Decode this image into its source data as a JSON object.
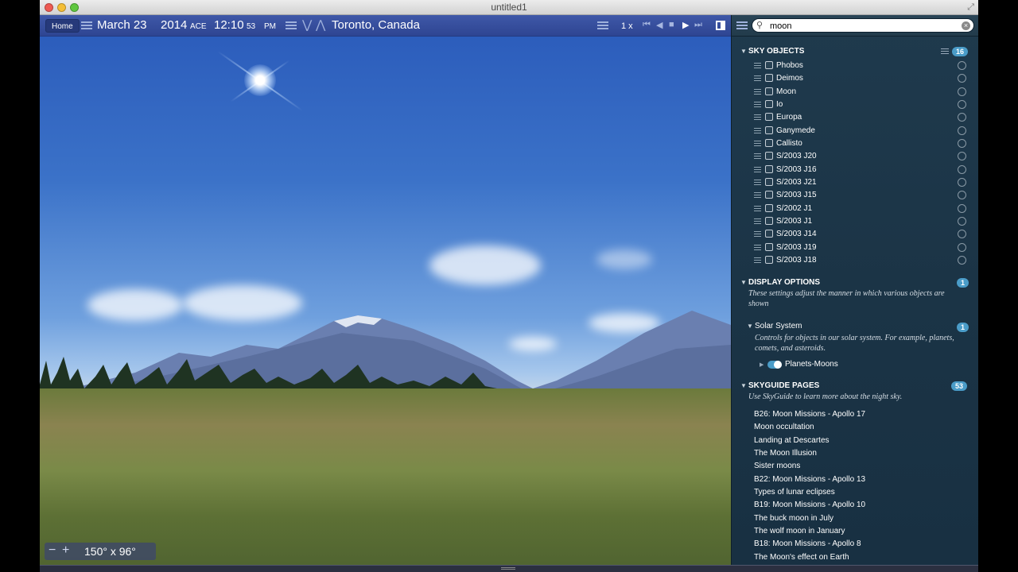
{
  "window": {
    "title": "untitled1"
  },
  "toolbar": {
    "home_label": "Home",
    "date": "March 23",
    "year": "2014",
    "era": "ACE",
    "time": "12:10",
    "seconds": "53",
    "ampm": "PM",
    "location": "Toronto, Canada",
    "speed": "1 x"
  },
  "fov": {
    "label": "150° x 96°"
  },
  "search": {
    "value": "moon"
  },
  "sky_objects": {
    "title": "SKY OBJECTS",
    "count": "16",
    "items": [
      "Phobos",
      "Deimos",
      "Moon",
      "Io",
      "Europa",
      "Ganymede",
      "Callisto",
      "S/2003 J20",
      "S/2003 J16",
      "S/2003 J21",
      "S/2003 J15",
      "S/2002 J1",
      "S/2003 J1",
      "S/2003 J14",
      "S/2003 J19",
      "S/2003 J18"
    ]
  },
  "display_options": {
    "title": "DISPLAY OPTIONS",
    "count": "1",
    "description": "These settings adjust the manner in which various objects are shown",
    "solar_system": {
      "title": "Solar System",
      "count": "1",
      "description": "Controls for objects in our solar system. For example, planets, comets, and asteroids.",
      "toggle_label": "Planets-Moons"
    }
  },
  "skyguide": {
    "title": "SKYGUIDE PAGES",
    "count": "53",
    "description": "Use SkyGuide to learn more about the night sky.",
    "pages": [
      "B26: Moon Missions - Apollo 17",
      "Moon occultation",
      "Landing at Descartes",
      "The Moon Illusion",
      "Sister moons",
      "B22: Moon Missions - Apollo 13",
      "Types of lunar eclipses",
      "B19: Moon Missions - Apollo 10",
      "The buck moon in July",
      "The wolf moon in January",
      "B18: Moon Missions - Apollo 8",
      "The Moon's effect on Earth"
    ]
  },
  "colors": {
    "toolbar": "#3349a0",
    "panel": "#1d3649",
    "badge": "#4a9cc8"
  }
}
